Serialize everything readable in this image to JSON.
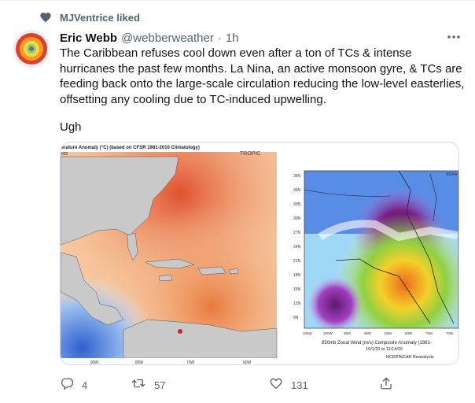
{
  "social_context": {
    "text": "MJVentrice liked",
    "icon": "heart-icon"
  },
  "tweet": {
    "author_name": "Eric Webb",
    "handle": "@webberweather",
    "separator": "·",
    "time": "1h",
    "text": "The Caribbean refuses cool down even after a ton of TCs & intense hurricanes the past few months. La Nina, an active monsoon gyre, & TCs are feeding back onto the large-scale circulation reducing the low-level easterlies, offsetting any cooling due to TC-induced upwelling.",
    "text_extra": "Ugh"
  },
  "media": {
    "left_map": {
      "title": "erature Anomaly (°C) (based on CFSR 1981-2010 Climatology)",
      "year_label": "020",
      "corner_label": "TROPIC",
      "lon_labels": [
        "90W",
        "80W",
        "70W",
        "60W"
      ]
    },
    "right_map": {
      "corner_label": "NOAA",
      "lat_labels": [
        "36N",
        "33N",
        "30N",
        "27N",
        "24N",
        "21N",
        "18N",
        "15N",
        "12N",
        "9N",
        "6N"
      ],
      "top_lat_label": "36N",
      "lon_labels": [
        "105W",
        "100W",
        "95W",
        "90W",
        "85W",
        "80W",
        "75W",
        "70W"
      ],
      "caption_line1": "850mb Zonal Wind (m/s) Composite Anomaly (1981-",
      "caption_line2": "10/1/20 to 11/14/20",
      "caption_line3": "NCEP/NCAR Reanalysis"
    }
  },
  "actions": {
    "reply_count": "4",
    "retweet_count": "57",
    "like_count": "131",
    "reply_icon": "reply-icon",
    "retweet_icon": "retweet-icon",
    "like_icon": "heart-outline-icon",
    "share_icon": "share-icon"
  },
  "colors": {
    "text": "#0f1419",
    "secondary": "#536471",
    "border": "#cfd9de"
  }
}
